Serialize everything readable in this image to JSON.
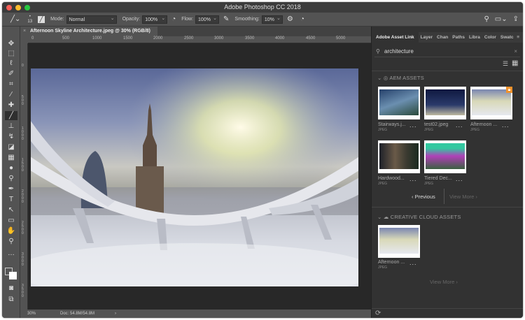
{
  "window": {
    "title": "Adobe Photoshop CC 2018"
  },
  "options": {
    "brush_size": "13",
    "mode_label": "Mode:",
    "mode_value": "Normal",
    "opacity_label": "Opacity:",
    "opacity_value": "100%",
    "flow_label": "Flow:",
    "flow_value": "100%",
    "smoothing_label": "Smoothing:",
    "smoothing_value": "10%"
  },
  "document": {
    "tab_title": "Afternoon Skyline Architecture.jpeg @ 30% (RGB/8)",
    "close": "×"
  },
  "ruler": {
    "h": [
      "0",
      "500",
      "1000",
      "1500",
      "2000",
      "2500",
      "3000",
      "3500",
      "4000",
      "4500",
      "5000"
    ],
    "v": [
      "0",
      "500",
      "1000",
      "1500",
      "2000",
      "2500",
      "3000",
      "3500"
    ]
  },
  "status": {
    "zoom": "30%",
    "doc": "Doc: 54.8M/54.8M",
    "arrow": "›"
  },
  "panel": {
    "tabs": [
      "Adobe Asset Link",
      "Layer",
      "Chan",
      "Paths",
      "Libra",
      "Color",
      "Swatc"
    ],
    "search_value": "architecture",
    "aem_header": "AEM ASSETS",
    "aem_assets": [
      {
        "name": "Stairways.j...",
        "type": "JPEG"
      },
      {
        "name": "test02.jpeg",
        "type": "JPEG"
      },
      {
        "name": "Afternoon ...",
        "type": "JPEG",
        "locked": true
      },
      {
        "name": "Hardwood...",
        "type": "JPEG"
      },
      {
        "name": "Tiered Dec...",
        "type": "JPEG"
      }
    ],
    "previous": "Previous",
    "view_more": "View More",
    "cc_header": "CREATIVE CLOUD ASSETS",
    "cc_assets": [
      {
        "name": "Afternoon ...",
        "type": "JPEG"
      }
    ],
    "cc_view_more": "View More",
    "more_dots": "..."
  },
  "colors": {
    "accent_lock": "#f0922b"
  }
}
